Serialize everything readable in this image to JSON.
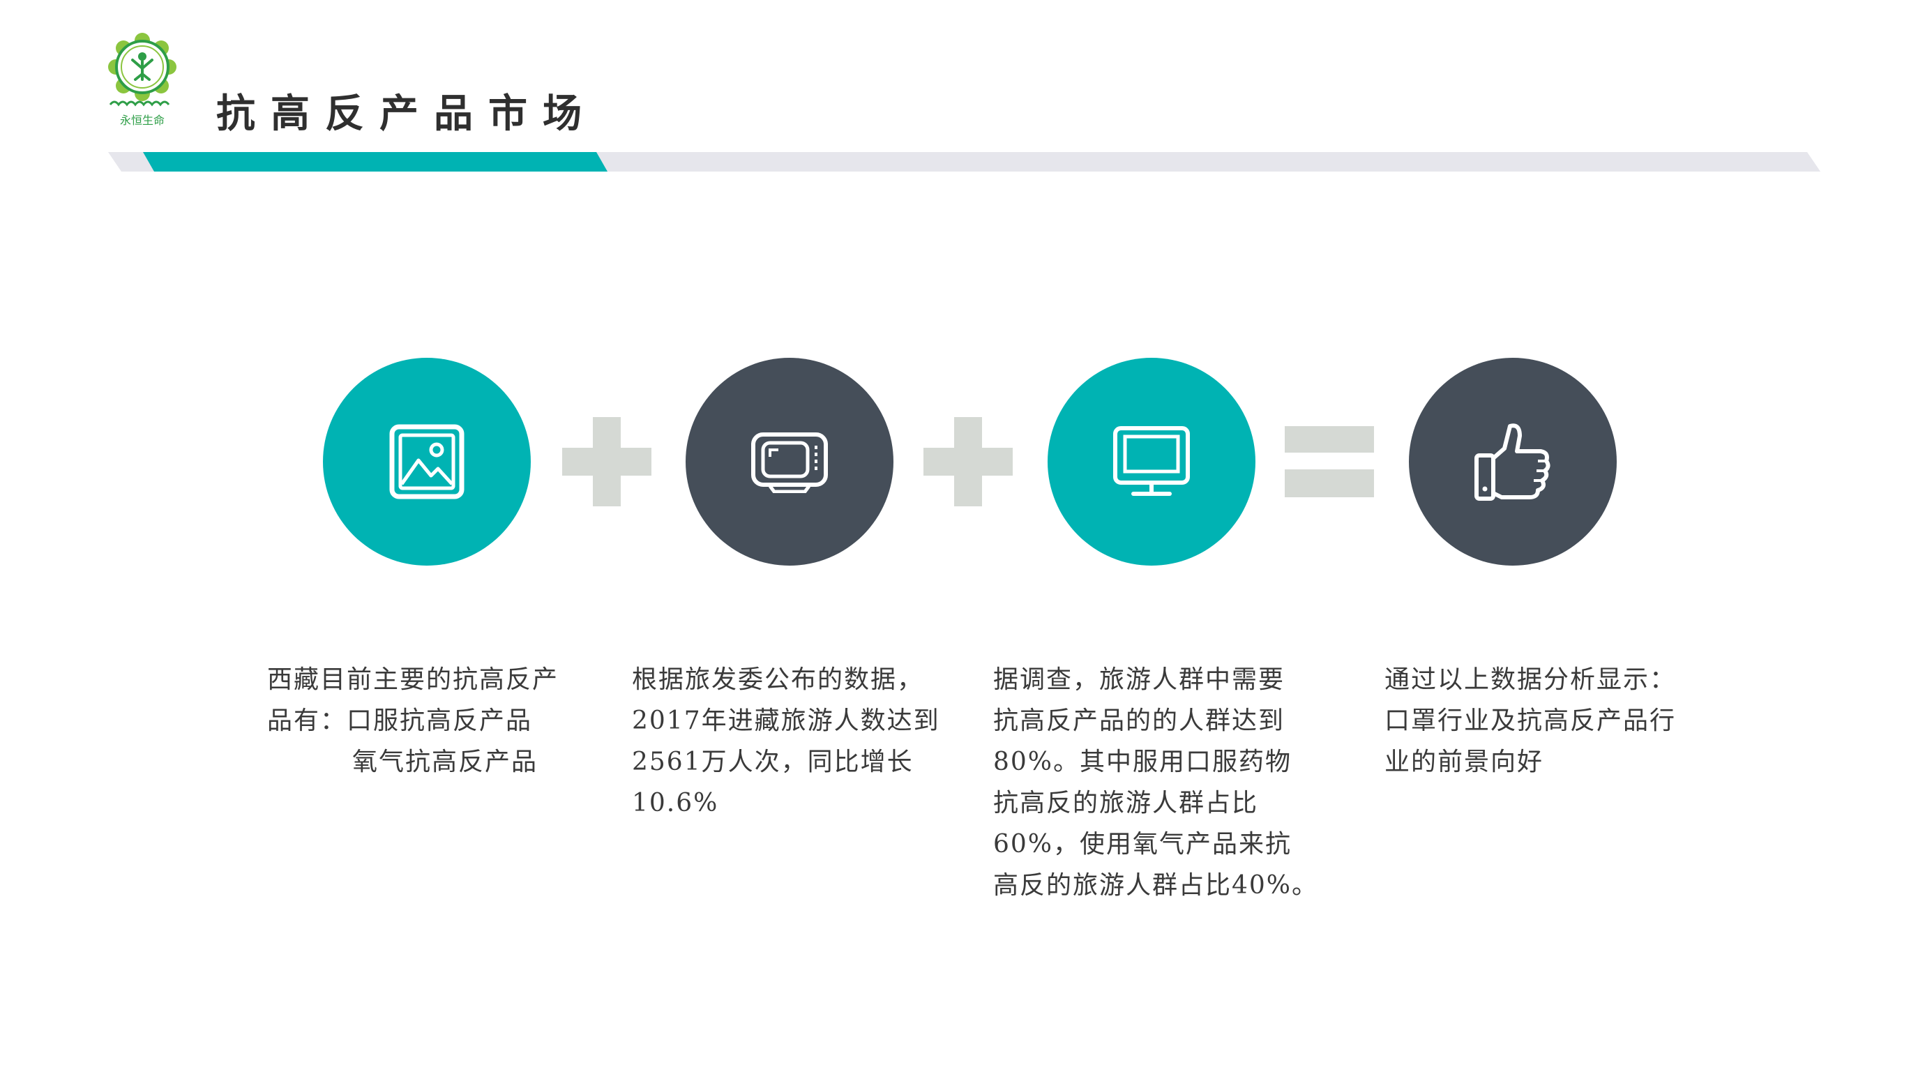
{
  "header": {
    "title": "抗高反产品市场",
    "logo_text": "永恒生命",
    "accent_color": "#00b3b3",
    "bar_color": "#e6e6ec"
  },
  "equation": {
    "items": [
      {
        "icon": "picture-icon",
        "color": "#00b3b3"
      },
      {
        "icon": "tv-icon",
        "color": "#454e59"
      },
      {
        "icon": "monitor-icon",
        "color": "#00b3b3"
      },
      {
        "icon": "thumbs-up-icon",
        "color": "#454e59"
      }
    ],
    "operators": [
      "plus",
      "plus",
      "equals"
    ],
    "operator_color": "#d5d9d4"
  },
  "descriptions": [
    {
      "lines": [
        "西藏目前主要的抗高反产",
        "品有：口服抗高反产品",
        "氧气抗高反产品"
      ]
    },
    {
      "lines": [
        "根据旅发委公布的数据，",
        "2017年进藏旅游人数达到",
        "2561万人次，同比增长",
        "10.6%"
      ]
    },
    {
      "lines": [
        "据调查，旅游人群中需要",
        "抗高反产品的的人群达到",
        "80%。其中服用口服药物",
        "抗高反的旅游人群占比",
        "60%，使用氧气产品来抗",
        "高反的旅游人群占比40%。"
      ]
    },
    {
      "lines": [
        "通过以上数据分析显示：",
        "口罩行业及抗高反产品行",
        "业的前景向好"
      ]
    }
  ]
}
